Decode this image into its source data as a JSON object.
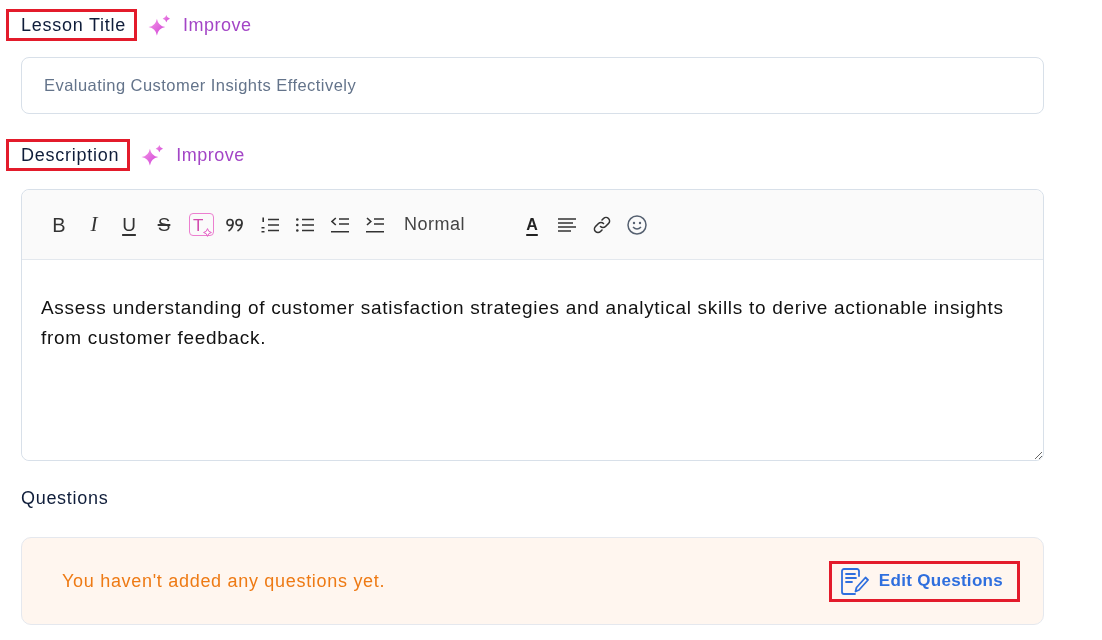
{
  "lesson_title": {
    "label": "Lesson Title",
    "highlighted": true,
    "improve": "Improve",
    "value": "Evaluating Customer Insights Effectively"
  },
  "description": {
    "label": "Description",
    "highlighted": true,
    "improve": "Improve",
    "toolbar": [
      {
        "kind": "bold",
        "glyph": "B"
      },
      {
        "kind": "italic",
        "glyph": "I"
      },
      {
        "kind": "underline",
        "glyph": "U"
      },
      {
        "kind": "strike",
        "glyph": "S"
      },
      {
        "kind": "ai",
        "glyph": "T"
      },
      {
        "kind": "quote"
      },
      {
        "kind": "ordered_list"
      },
      {
        "kind": "bullet_list"
      },
      {
        "kind": "outdent"
      },
      {
        "kind": "indent"
      },
      {
        "kind": "style",
        "label": "Normal"
      },
      {
        "kind": "color",
        "glyph": "A"
      },
      {
        "kind": "align"
      },
      {
        "kind": "link"
      },
      {
        "kind": "emoji"
      }
    ],
    "value": "Assess understanding of customer satisfaction strategies and analytical skills to derive actionable insights from customer feedback."
  },
  "questions": {
    "label": "Questions",
    "message": "You haven't added any questions yet.",
    "edit_button": {
      "label": "Edit Questions",
      "highlighted": true
    }
  }
}
